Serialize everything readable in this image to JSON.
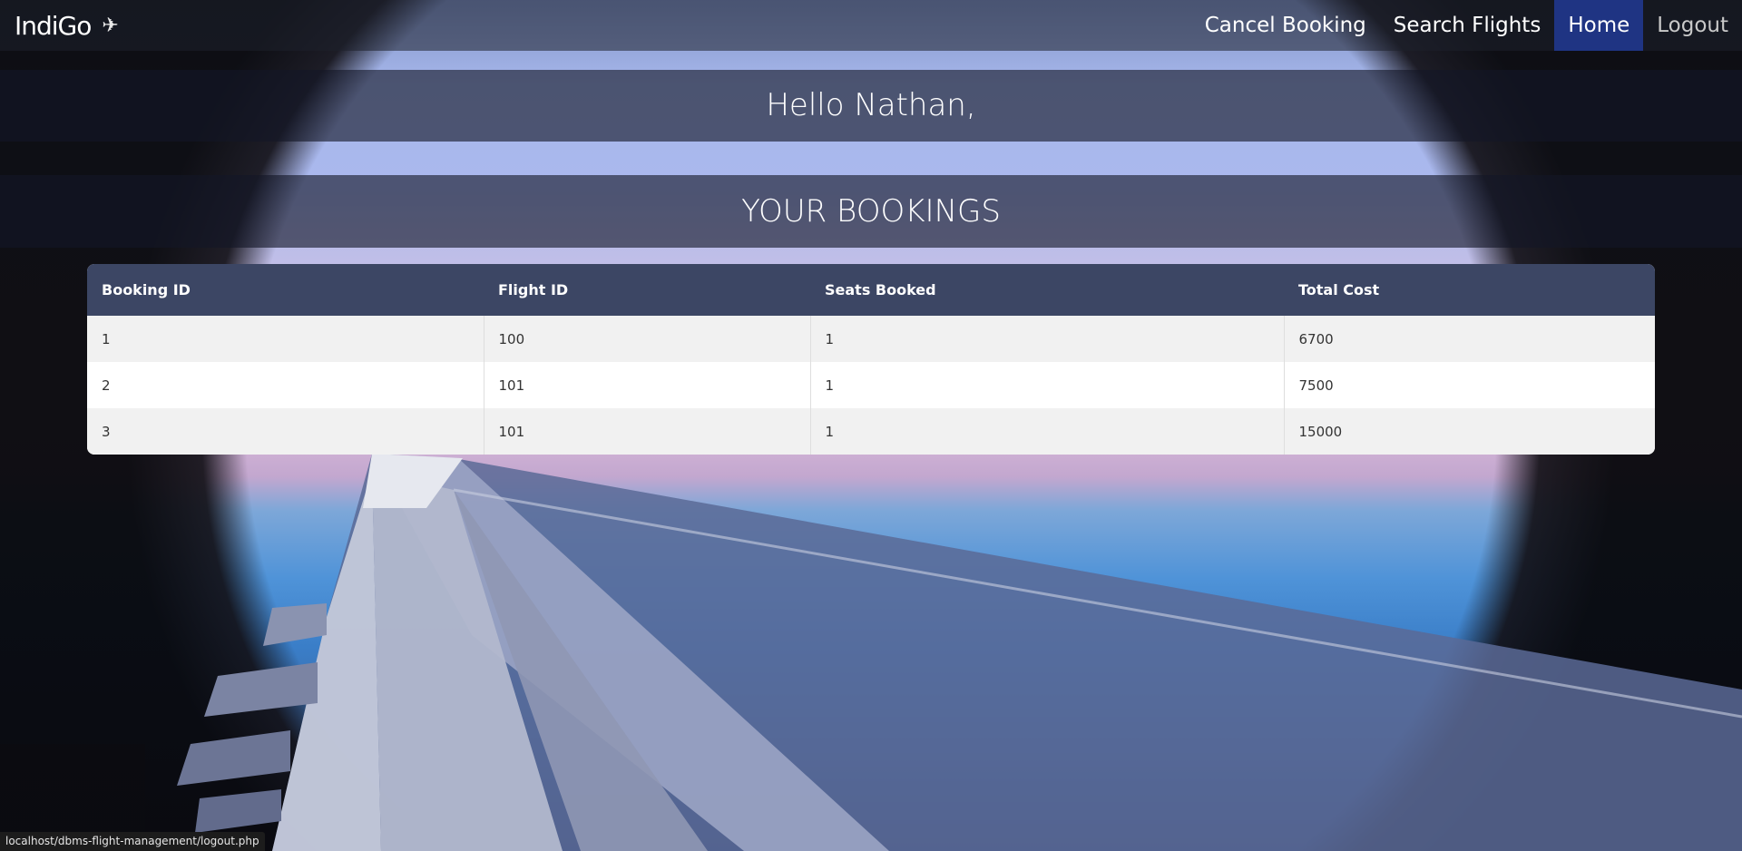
{
  "navbar": {
    "brand": "IndiGo",
    "links": {
      "cancel_booking": "Cancel Booking",
      "search_flights": "Search Flights",
      "home": "Home",
      "logout": "Logout"
    },
    "active": "Home",
    "active_color": "#1f3483"
  },
  "greeting": "Hello Nathan,",
  "section_title": "YOUR BOOKINGS",
  "bookings": {
    "headers": [
      "Booking ID",
      "Flight ID",
      "Seats Booked",
      "Total Cost"
    ],
    "rows": [
      [
        "1",
        "100",
        "1",
        "6700"
      ],
      [
        "2",
        "101",
        "1",
        "7500"
      ],
      [
        "3",
        "101",
        "1",
        "15000"
      ]
    ]
  },
  "status_bar": {
    "url": "localhost/dbms-flight-management/logout.php"
  },
  "colors": {
    "table_header": "#3c4664"
  },
  "icons": {
    "brand_icon": "airplane-icon"
  }
}
